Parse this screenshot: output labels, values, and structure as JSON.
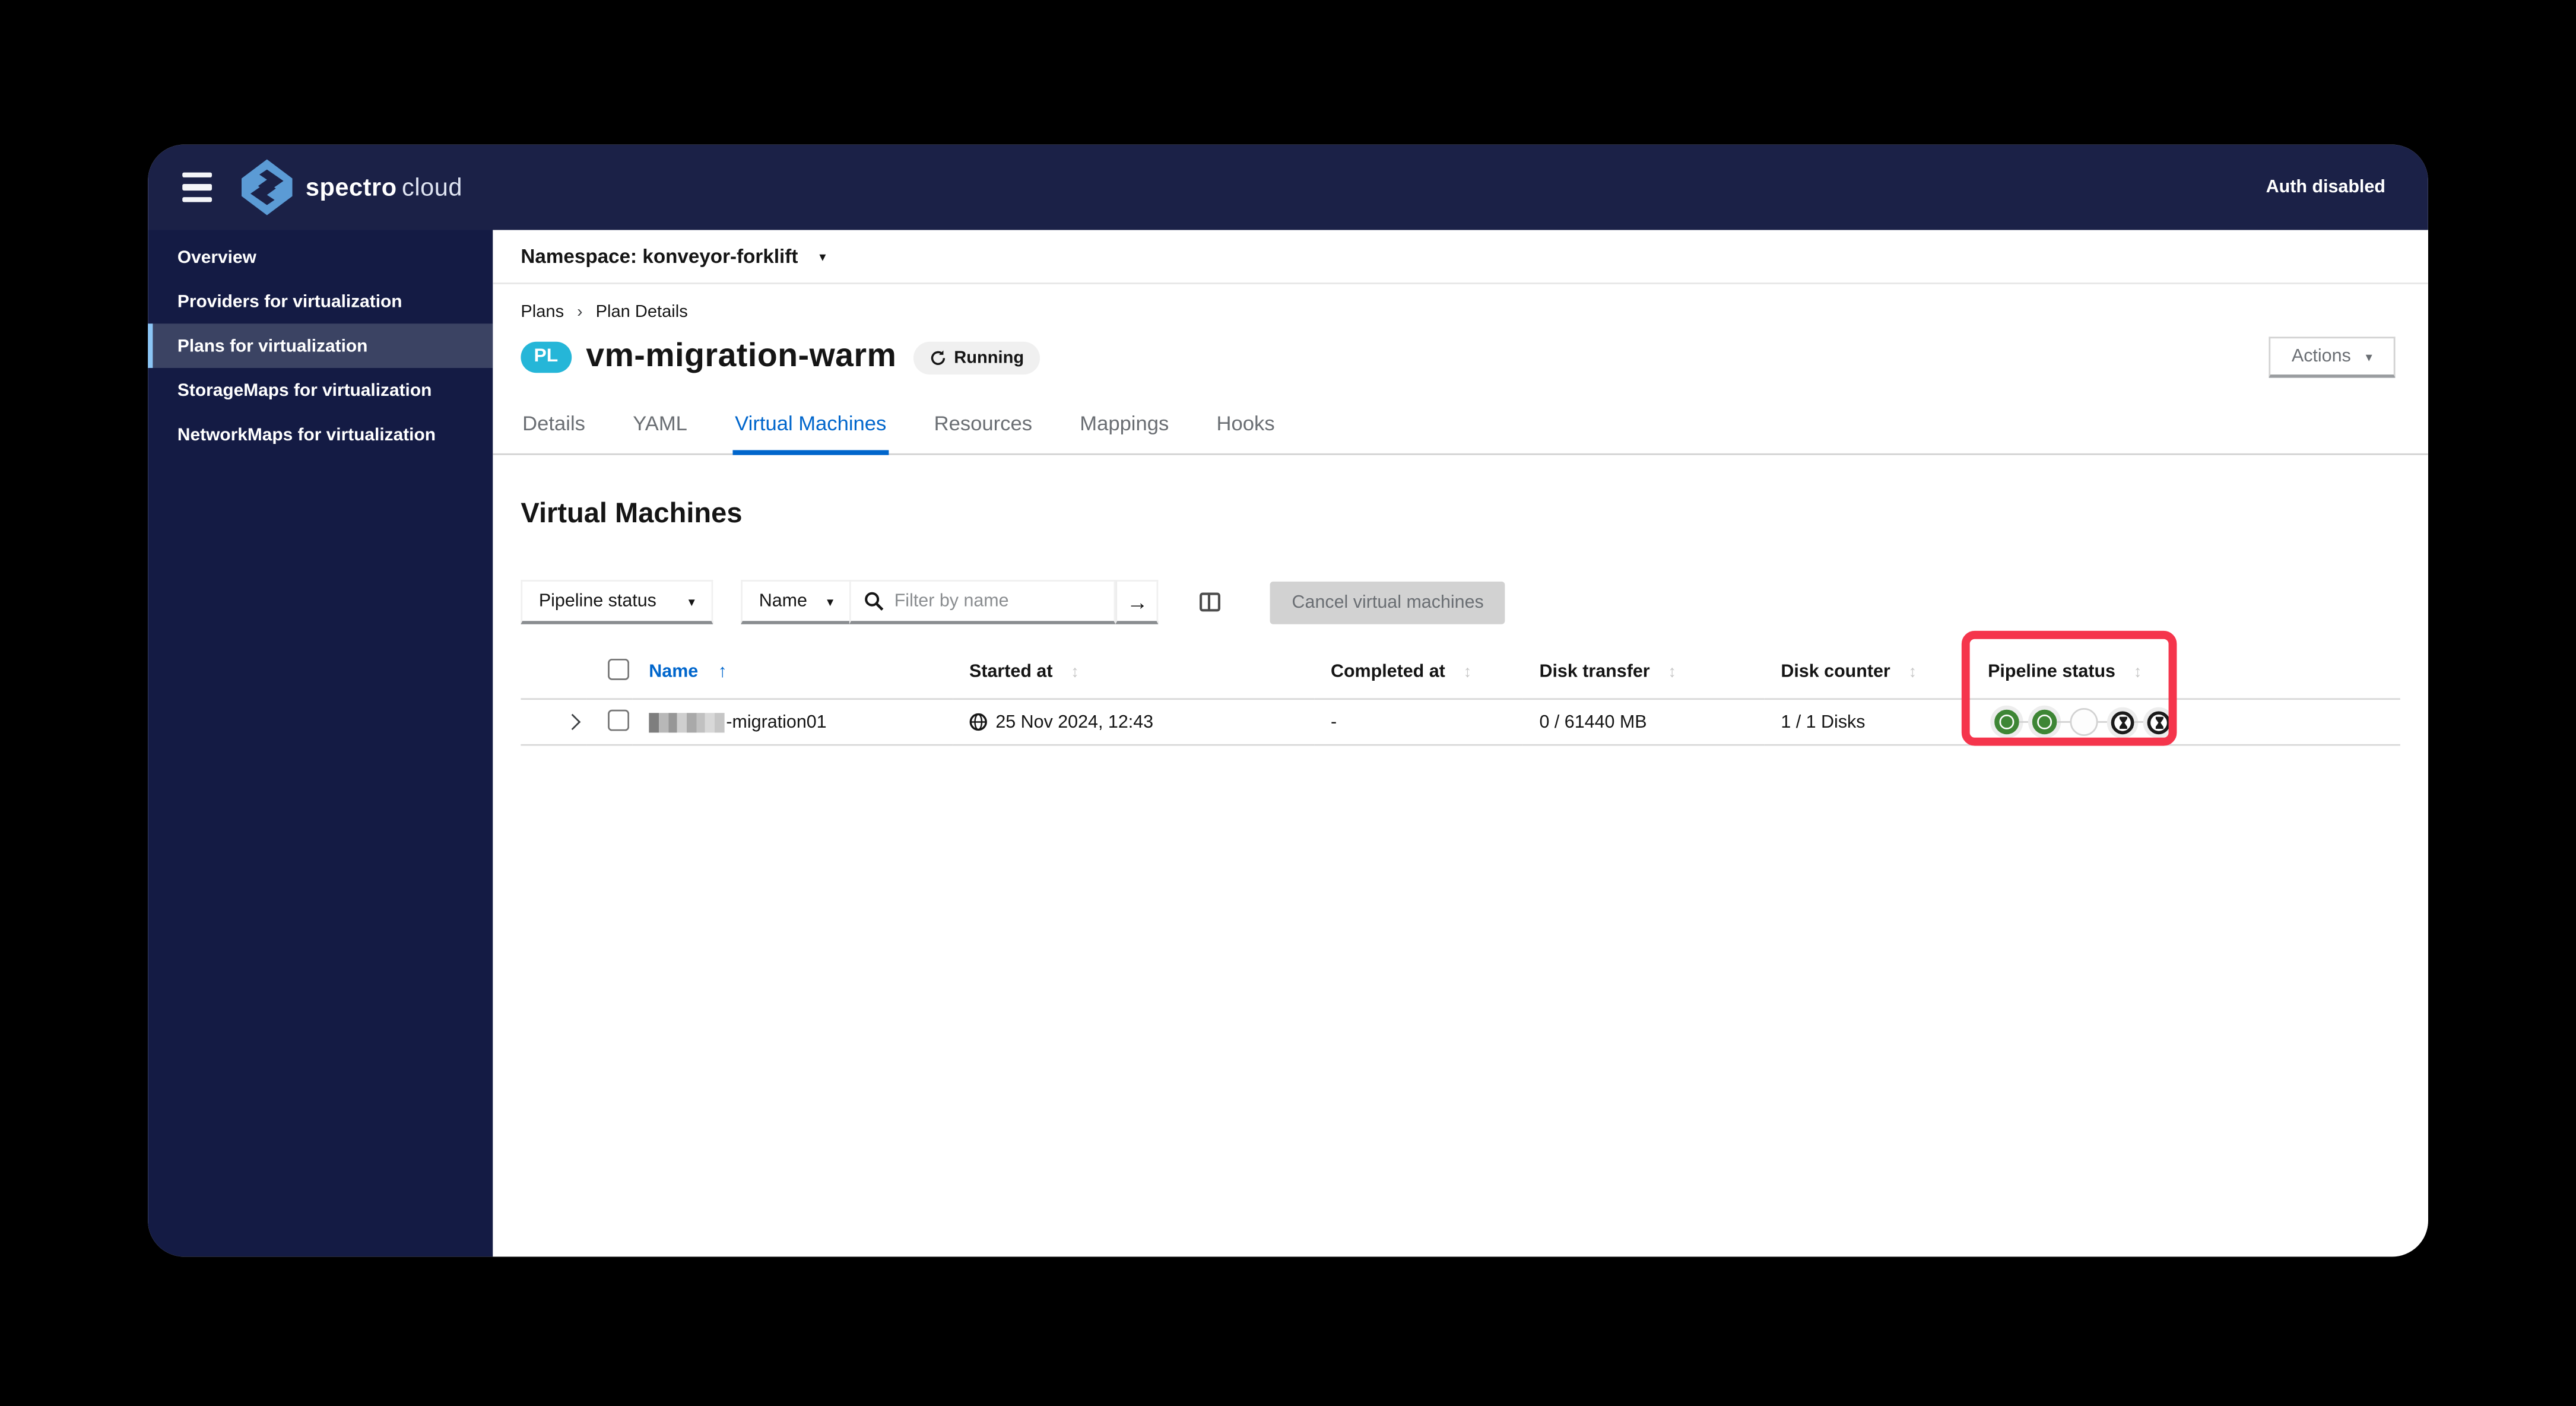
{
  "topbar": {
    "brand_primary": "spectro",
    "brand_secondary": "cloud",
    "auth_status": "Auth disabled"
  },
  "sidebar": {
    "items": [
      {
        "label": "Overview",
        "active": false
      },
      {
        "label": "Providers for virtualization",
        "active": false
      },
      {
        "label": "Plans for virtualization",
        "active": true
      },
      {
        "label": "StorageMaps for virtualization",
        "active": false
      },
      {
        "label": "NetworkMaps for virtualization",
        "active": false
      }
    ]
  },
  "content": {
    "namespace": {
      "label": "Namespace: konveyor-forklift"
    },
    "breadcrumb": {
      "items": [
        "Plans",
        "Plan Details"
      ]
    },
    "plan": {
      "badge": "PL",
      "title": "vm-migration-warm",
      "status": "Running"
    },
    "actions_button": "Actions",
    "tabs": [
      {
        "label": "Details",
        "active": false
      },
      {
        "label": "YAML",
        "active": false
      },
      {
        "label": "Virtual Machines",
        "active": true
      },
      {
        "label": "Resources",
        "active": false
      },
      {
        "label": "Mappings",
        "active": false
      },
      {
        "label": "Hooks",
        "active": false
      }
    ],
    "heading": "Virtual Machines",
    "filters": {
      "status_filter": "Pipeline status",
      "field_filter": "Name",
      "search_placeholder": "Filter by name",
      "cancel_button": "Cancel virtual machines"
    },
    "table": {
      "columns": [
        {
          "label": "Name",
          "sorted": "asc"
        },
        {
          "label": "Started at",
          "sorted": "none"
        },
        {
          "label": "Completed at",
          "sorted": "none"
        },
        {
          "label": "Disk transfer",
          "sorted": "none"
        },
        {
          "label": "Disk counter",
          "sorted": "none"
        },
        {
          "label": "Pipeline status",
          "sorted": "none"
        }
      ],
      "rows": [
        {
          "name_visible": "-migration01",
          "name_redacted": true,
          "started_at": "25 Nov 2024, 12:43",
          "completed_at": "-",
          "disk_transfer": "0 / 61440 MB",
          "disk_counter": "1 / 1 Disks",
          "pipeline_steps": [
            "done",
            "done",
            "empty",
            "pending",
            "pending"
          ]
        }
      ]
    }
  },
  "colors": {
    "topbar_navy": "#1b2147",
    "sidebar_navy": "#141b44",
    "sidebar_active": "#3b4363",
    "sidebar_accent": "#8bc5f5",
    "badge_cyan": "#25b6d8",
    "tab_active_blue": "#0066cc",
    "step_green": "#3e8635",
    "annotation_red": "#f5354c",
    "disabled_gray": "#d2d2d2"
  }
}
